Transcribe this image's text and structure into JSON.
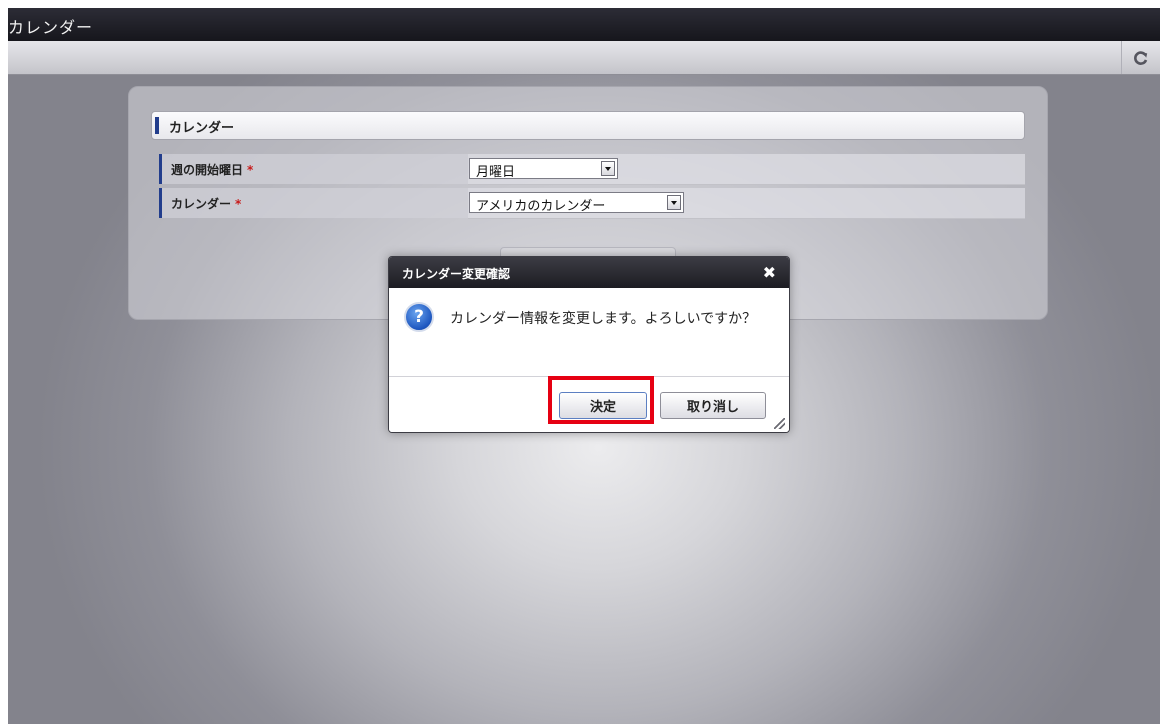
{
  "window": {
    "title": "カレンダー"
  },
  "toolbar": {
    "refresh_icon": "refresh-icon"
  },
  "section": {
    "title": "カレンダー"
  },
  "form": {
    "fields": [
      {
        "label": "週の開始曜日",
        "required_mark": "*",
        "value": "月曜日"
      },
      {
        "label": "カレンダー",
        "required_mark": "*",
        "value": "アメリカのカレンダー"
      }
    ]
  },
  "dialog": {
    "title": "カレンダー変更確認",
    "close_icon": "close-icon",
    "message_icon": "question-icon",
    "message": "カレンダー情報を変更します。よろしいですか？",
    "ok_label": "決定",
    "cancel_label": "取り消し"
  },
  "colors": {
    "accent": "#223d8c",
    "highlight": "#e60012",
    "titlebar": "#1c1c22"
  }
}
